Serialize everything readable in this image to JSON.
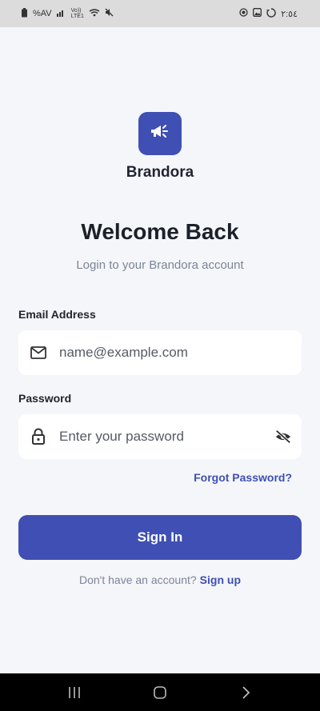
{
  "status_bar": {
    "left_text": "%AV",
    "network_small": "Vo)) LTE1",
    "time": "٢:٥٤"
  },
  "app": {
    "brand_name": "Brandora",
    "logo_icon": "megaphone-icon",
    "title": "Welcome Back",
    "subtitle": "Login to your Brandora account",
    "email": {
      "label": "Email Address",
      "placeholder": "name@example.com",
      "value": "",
      "icon": "mail-icon"
    },
    "password": {
      "label": "Password",
      "placeholder": "Enter your password",
      "value": "",
      "icon": "lock-icon",
      "toggle_icon": "eye-off-icon"
    },
    "forgot_label": "Forgot Password?",
    "signin_label": "Sign In",
    "signup_prompt": "Don't have an account?",
    "signup_label": "Sign up"
  },
  "colors": {
    "primary": "#3f4fb3",
    "background": "#f5f6fa",
    "field_bg": "#ffffff"
  }
}
